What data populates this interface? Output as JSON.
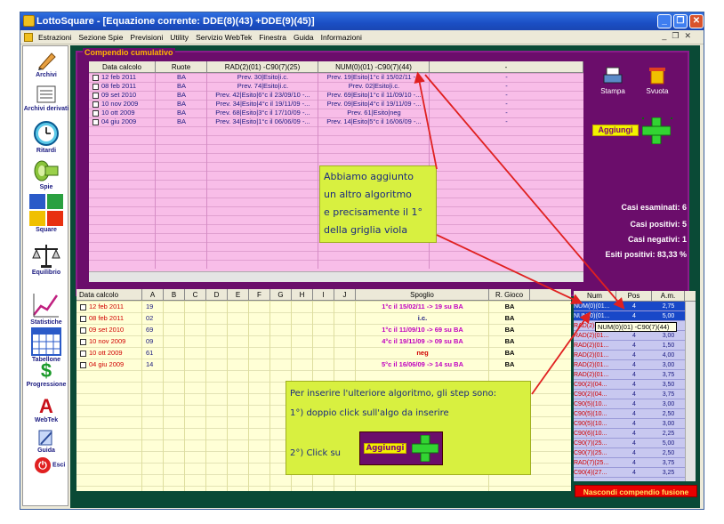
{
  "window": {
    "title": "LottoSquare - [Equazione corrente: DDE(8)(43) +DDE(9)(45)]"
  },
  "menu": [
    "Estrazioni",
    "Sezione Spie",
    "Previsioni",
    "Utility",
    "Servizio WebTek",
    "Finestra",
    "Guida",
    "Informazioni"
  ],
  "sidebar": {
    "items": [
      {
        "label": "Archivi",
        "icon": "pencil-icon"
      },
      {
        "label": "Archivi derivati",
        "icon": "archive-icon"
      },
      {
        "label": "Ritardi",
        "icon": "clock-icon"
      },
      {
        "label": "Spie",
        "icon": "pipe-icon"
      },
      {
        "label": "Square",
        "icon": "square-grid-icon"
      },
      {
        "label": "Equilibrio",
        "icon": "scale-icon"
      },
      {
        "label": "Statistiche",
        "icon": "chart-icon"
      },
      {
        "label": "Tabellone",
        "icon": "calendar-icon"
      },
      {
        "label": "Progressione",
        "icon": "dollar-icon"
      },
      {
        "label": "WebTek",
        "icon": "webtek-icon"
      },
      {
        "label": "Guida",
        "icon": "guide-icon"
      },
      {
        "label": "Esci",
        "icon": "exit-icon"
      }
    ]
  },
  "compendio": {
    "title": "Compendio cumulativo",
    "columns": [
      "Data calcolo",
      "Ruote",
      "RAD(2)(01) -C90(7)(25)",
      "NUM(0)(01) -C90(7)(44)",
      "-"
    ],
    "rows": [
      {
        "date": "12 feb 2011",
        "ruote": "BA",
        "rad": "Prev. 30|Esito|i.c.",
        "num": "Prev. 19|Esito|1°c il 15/02/11 -...",
        "dash": "-"
      },
      {
        "date": "08 feb 2011",
        "ruote": "BA",
        "rad": "Prev. 74|Esito|i.c.",
        "num": "Prev. 02|Esito|i.c.",
        "dash": "-"
      },
      {
        "date": "09 set 2010",
        "ruote": "BA",
        "rad": "Prev. 42|Esito|6°c il 23/09/10 -...",
        "num": "Prev. 69|Esito|1°c il 11/09/10 -...",
        "dash": "-"
      },
      {
        "date": "10 nov 2009",
        "ruote": "BA",
        "rad": "Prev. 34|Esito|4°c il 19/11/09 -...",
        "num": "Prev. 09|Esito|4°c il 19/11/09 -...",
        "dash": "-"
      },
      {
        "date": "10 ott 2009",
        "ruote": "BA",
        "rad": "Prev. 68|Esito|3°c il 17/10/09 -...",
        "num": "Prev. 61|Esito|neg",
        "dash": "-"
      },
      {
        "date": "04 giu 2009",
        "ruote": "BA",
        "rad": "Prev. 34|Esito|1°c il 06/06/09 -...",
        "num": "Prev. 14|Esito|5°c il 16/06/09 -...",
        "dash": "-"
      }
    ],
    "stampa_label": "Stampa",
    "svuota_label": "Svuota",
    "aggiungi_label": "Aggiungi",
    "stats": {
      "esaminati": "Casi esaminati: 6",
      "positivi": "Casi positivi: 5",
      "negativi": "Casi negativi: 1",
      "esiti": "Esiti positivi: 83,33 %"
    }
  },
  "results": {
    "columns": [
      "Data calcolo",
      "A",
      "B",
      "C",
      "D",
      "E",
      "F",
      "G",
      "H",
      "I",
      "J",
      "Spoglio",
      "R. Gioco"
    ],
    "rows": [
      {
        "date": "12 feb 2011",
        "a": "19",
        "spoglio": "1°c il 15/02/11 -> 19 su BA",
        "gioco": "BA",
        "status": "pos"
      },
      {
        "date": "08 feb 2011",
        "a": "02",
        "spoglio": "i.c.",
        "gioco": "BA",
        "status": "ic"
      },
      {
        "date": "09 set 2010",
        "a": "69",
        "spoglio": "1°c il 11/09/10 -> 69 su BA",
        "gioco": "BA",
        "status": "pos"
      },
      {
        "date": "10 nov 2009",
        "a": "09",
        "spoglio": "4°c il 19/11/09 -> 09 su BA",
        "gioco": "BA",
        "status": "pos"
      },
      {
        "date": "10 ott 2009",
        "a": "61",
        "spoglio": "neg",
        "gioco": "BA",
        "status": "neg"
      },
      {
        "date": "04 giu 2009",
        "a": "14",
        "spoglio": "5°c il 16/06/09 -> 14 su BA",
        "gioco": "BA",
        "status": "pos"
      }
    ]
  },
  "algos": {
    "columns": [
      "Num",
      "Pos",
      "A.m."
    ],
    "rows": [
      {
        "num": "NUM(0)(01...",
        "pos": "4",
        "am": "2,75"
      },
      {
        "num": "NUM(0)(01...",
        "pos": "4",
        "am": "5,00"
      },
      {
        "num": "RAD(2)(01...",
        "pos": "4",
        "am": "2,75"
      },
      {
        "num": "RAD(2)(01...",
        "pos": "4",
        "am": "3,00"
      },
      {
        "num": "RAD(2)(01...",
        "pos": "4",
        "am": "1,50"
      },
      {
        "num": "RAD(2)(01...",
        "pos": "4",
        "am": "4,00"
      },
      {
        "num": "RAD(2)(01...",
        "pos": "4",
        "am": "3,00"
      },
      {
        "num": "RAD(2)(01...",
        "pos": "4",
        "am": "3,75"
      },
      {
        "num": "C90(2)(04...",
        "pos": "4",
        "am": "3,50"
      },
      {
        "num": "C90(2)(04...",
        "pos": "4",
        "am": "3,75"
      },
      {
        "num": "C90(5)(10...",
        "pos": "4",
        "am": "3,00"
      },
      {
        "num": "C90(5)(10...",
        "pos": "4",
        "am": "2,50"
      },
      {
        "num": "C90(5)(10...",
        "pos": "4",
        "am": "3,00"
      },
      {
        "num": "C90(6)(10...",
        "pos": "4",
        "am": "2,25"
      },
      {
        "num": "C90(7)(25...",
        "pos": "4",
        "am": "5,00"
      },
      {
        "num": "C90(7)(25...",
        "pos": "4",
        "am": "2,50"
      },
      {
        "num": "RAD(7)(25...",
        "pos": "4",
        "am": "3,75"
      },
      {
        "num": "C90(4)(27...",
        "pos": "4",
        "am": "3,25"
      }
    ],
    "tooltip": "NUM(0)(01) -C90(7)(44)",
    "hide_label": "Nascondi compendio fusione"
  },
  "notes": {
    "note1": [
      "Abbiamo aggiunto",
      "un altro algoritmo",
      "e precisamente il 1°",
      "della griglia viola"
    ],
    "note2_line1": "Per inserire l'ulteriore algoritmo, gli step sono:",
    "note2_line2": "1°) doppio click sull'algo da inserire",
    "note2_line3": "2°) Click su",
    "note2_btn": "Aggiungi"
  }
}
